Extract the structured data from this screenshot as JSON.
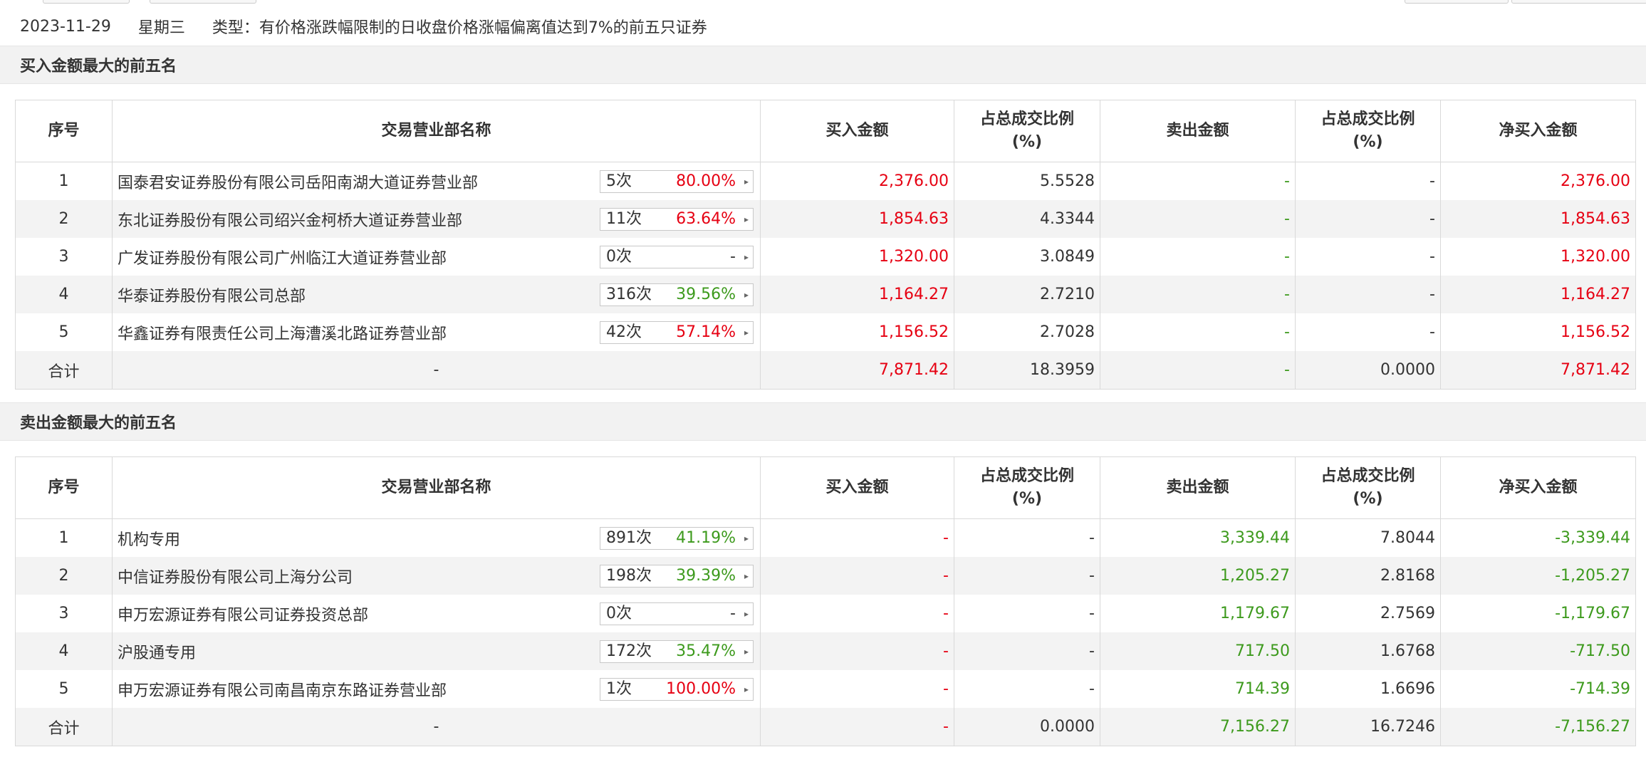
{
  "header": {
    "date": "2023-11-29",
    "weekday": "星期三",
    "type_text": "类型：有价格涨跌幅限制的日收盘价格涨幅偏离值达到7%的前五只证券"
  },
  "columns": [
    "序号",
    "交易营业部名称",
    "买入金额",
    "占总成交比例\n(%)",
    "卖出金额",
    "占总成交比例\n(%)",
    "净买入金额"
  ],
  "colors": {
    "red": "#e60012",
    "green": "#3d9a1d"
  },
  "buy": {
    "title": "买入金额最大的前五名",
    "rows": [
      {
        "idx": "1",
        "name": "国泰君安证券股份有限公司岳阳南湖大道证券营业部",
        "count": "5次",
        "pct": "80.00%",
        "pct_color": "red",
        "buy": "2,376.00",
        "buy_ratio": "5.5528",
        "sell": "-",
        "sell_ratio": "-",
        "net": "2,376.00"
      },
      {
        "idx": "2",
        "name": "东北证券股份有限公司绍兴金柯桥大道证券营业部",
        "count": "11次",
        "pct": "63.64%",
        "pct_color": "red",
        "buy": "1,854.63",
        "buy_ratio": "4.3344",
        "sell": "-",
        "sell_ratio": "-",
        "net": "1,854.63"
      },
      {
        "idx": "3",
        "name": "广发证券股份有限公司广州临江大道证券营业部",
        "count": "0次",
        "pct": "-",
        "pct_color": "gray",
        "buy": "1,320.00",
        "buy_ratio": "3.0849",
        "sell": "-",
        "sell_ratio": "-",
        "net": "1,320.00"
      },
      {
        "idx": "4",
        "name": "华泰证券股份有限公司总部",
        "count": "316次",
        "pct": "39.56%",
        "pct_color": "green",
        "buy": "1,164.27",
        "buy_ratio": "2.7210",
        "sell": "-",
        "sell_ratio": "-",
        "net": "1,164.27"
      },
      {
        "idx": "5",
        "name": "华鑫证券有限责任公司上海漕溪北路证券营业部",
        "count": "42次",
        "pct": "57.14%",
        "pct_color": "red",
        "buy": "1,156.52",
        "buy_ratio": "2.7028",
        "sell": "-",
        "sell_ratio": "-",
        "net": "1,156.52"
      }
    ],
    "total": {
      "label": "合计",
      "name": "-",
      "buy": "7,871.42",
      "buy_ratio": "18.3959",
      "sell": "-",
      "sell_ratio": "0.0000",
      "net": "7,871.42"
    }
  },
  "sell": {
    "title": "卖出金额最大的前五名",
    "rows": [
      {
        "idx": "1",
        "name": "机构专用",
        "count": "891次",
        "pct": "41.19%",
        "pct_color": "green",
        "buy": "-",
        "buy_ratio": "-",
        "sell": "3,339.44",
        "sell_ratio": "7.8044",
        "net": "-3,339.44"
      },
      {
        "idx": "2",
        "name": "中信证券股份有限公司上海分公司",
        "count": "198次",
        "pct": "39.39%",
        "pct_color": "green",
        "buy": "-",
        "buy_ratio": "-",
        "sell": "1,205.27",
        "sell_ratio": "2.8168",
        "net": "-1,205.27"
      },
      {
        "idx": "3",
        "name": "申万宏源证券有限公司证券投资总部",
        "count": "0次",
        "pct": "-",
        "pct_color": "gray",
        "buy": "-",
        "buy_ratio": "-",
        "sell": "1,179.67",
        "sell_ratio": "2.7569",
        "net": "-1,179.67"
      },
      {
        "idx": "4",
        "name": "沪股通专用",
        "count": "172次",
        "pct": "35.47%",
        "pct_color": "green",
        "buy": "-",
        "buy_ratio": "-",
        "sell": "717.50",
        "sell_ratio": "1.6768",
        "net": "-717.50"
      },
      {
        "idx": "5",
        "name": "申万宏源证券有限公司南昌南京东路证券营业部",
        "count": "1次",
        "pct": "100.00%",
        "pct_color": "red",
        "buy": "-",
        "buy_ratio": "-",
        "sell": "714.39",
        "sell_ratio": "1.6696",
        "net": "-714.39"
      }
    ],
    "total": {
      "label": "合计",
      "name": "-",
      "buy": "-",
      "buy_ratio": "0.0000",
      "sell": "7,156.27",
      "sell_ratio": "16.7246",
      "net": "-7,156.27"
    }
  }
}
